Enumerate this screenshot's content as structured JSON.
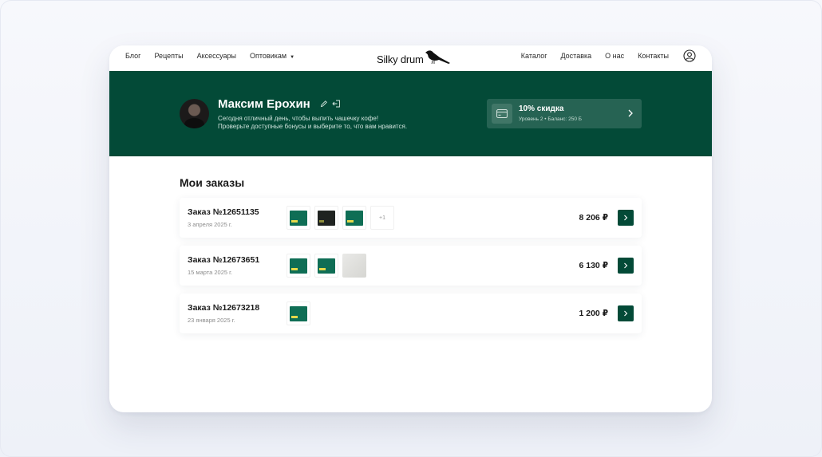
{
  "nav": {
    "left": [
      "Блог",
      "Рецепты",
      "Аксессуары",
      "Оптовикам"
    ],
    "right": [
      "Каталог",
      "Доставка",
      "О нас",
      "Контакты"
    ],
    "logo": "Silky drum"
  },
  "profile": {
    "name": "Максим Ерохин",
    "greeting_line1": "Сегодня отличный день, чтобы выпить чашечку кофе!",
    "greeting_line2": "Проверьте доступные бонусы и выберите то, что вам нравится."
  },
  "discount": {
    "title": "10% скидка",
    "subtitle": "Уровень 2 • Баланс: 250 Б"
  },
  "orders_title": "Мои заказы",
  "orders": [
    {
      "title": "Заказ №12651135",
      "date": "3 апреля 2025 г.",
      "price": "8 206 ₽",
      "more": "+1"
    },
    {
      "title": "Заказ №12673651",
      "date": "15 марта 2025 г.",
      "price": "6 130 ₽"
    },
    {
      "title": "Заказ №12673218",
      "date": "23 января 2025 г.",
      "price": "1 200 ₽"
    }
  ],
  "colors": {
    "brand_green": "#034a37",
    "accent_yellow": "#e5d94a"
  }
}
